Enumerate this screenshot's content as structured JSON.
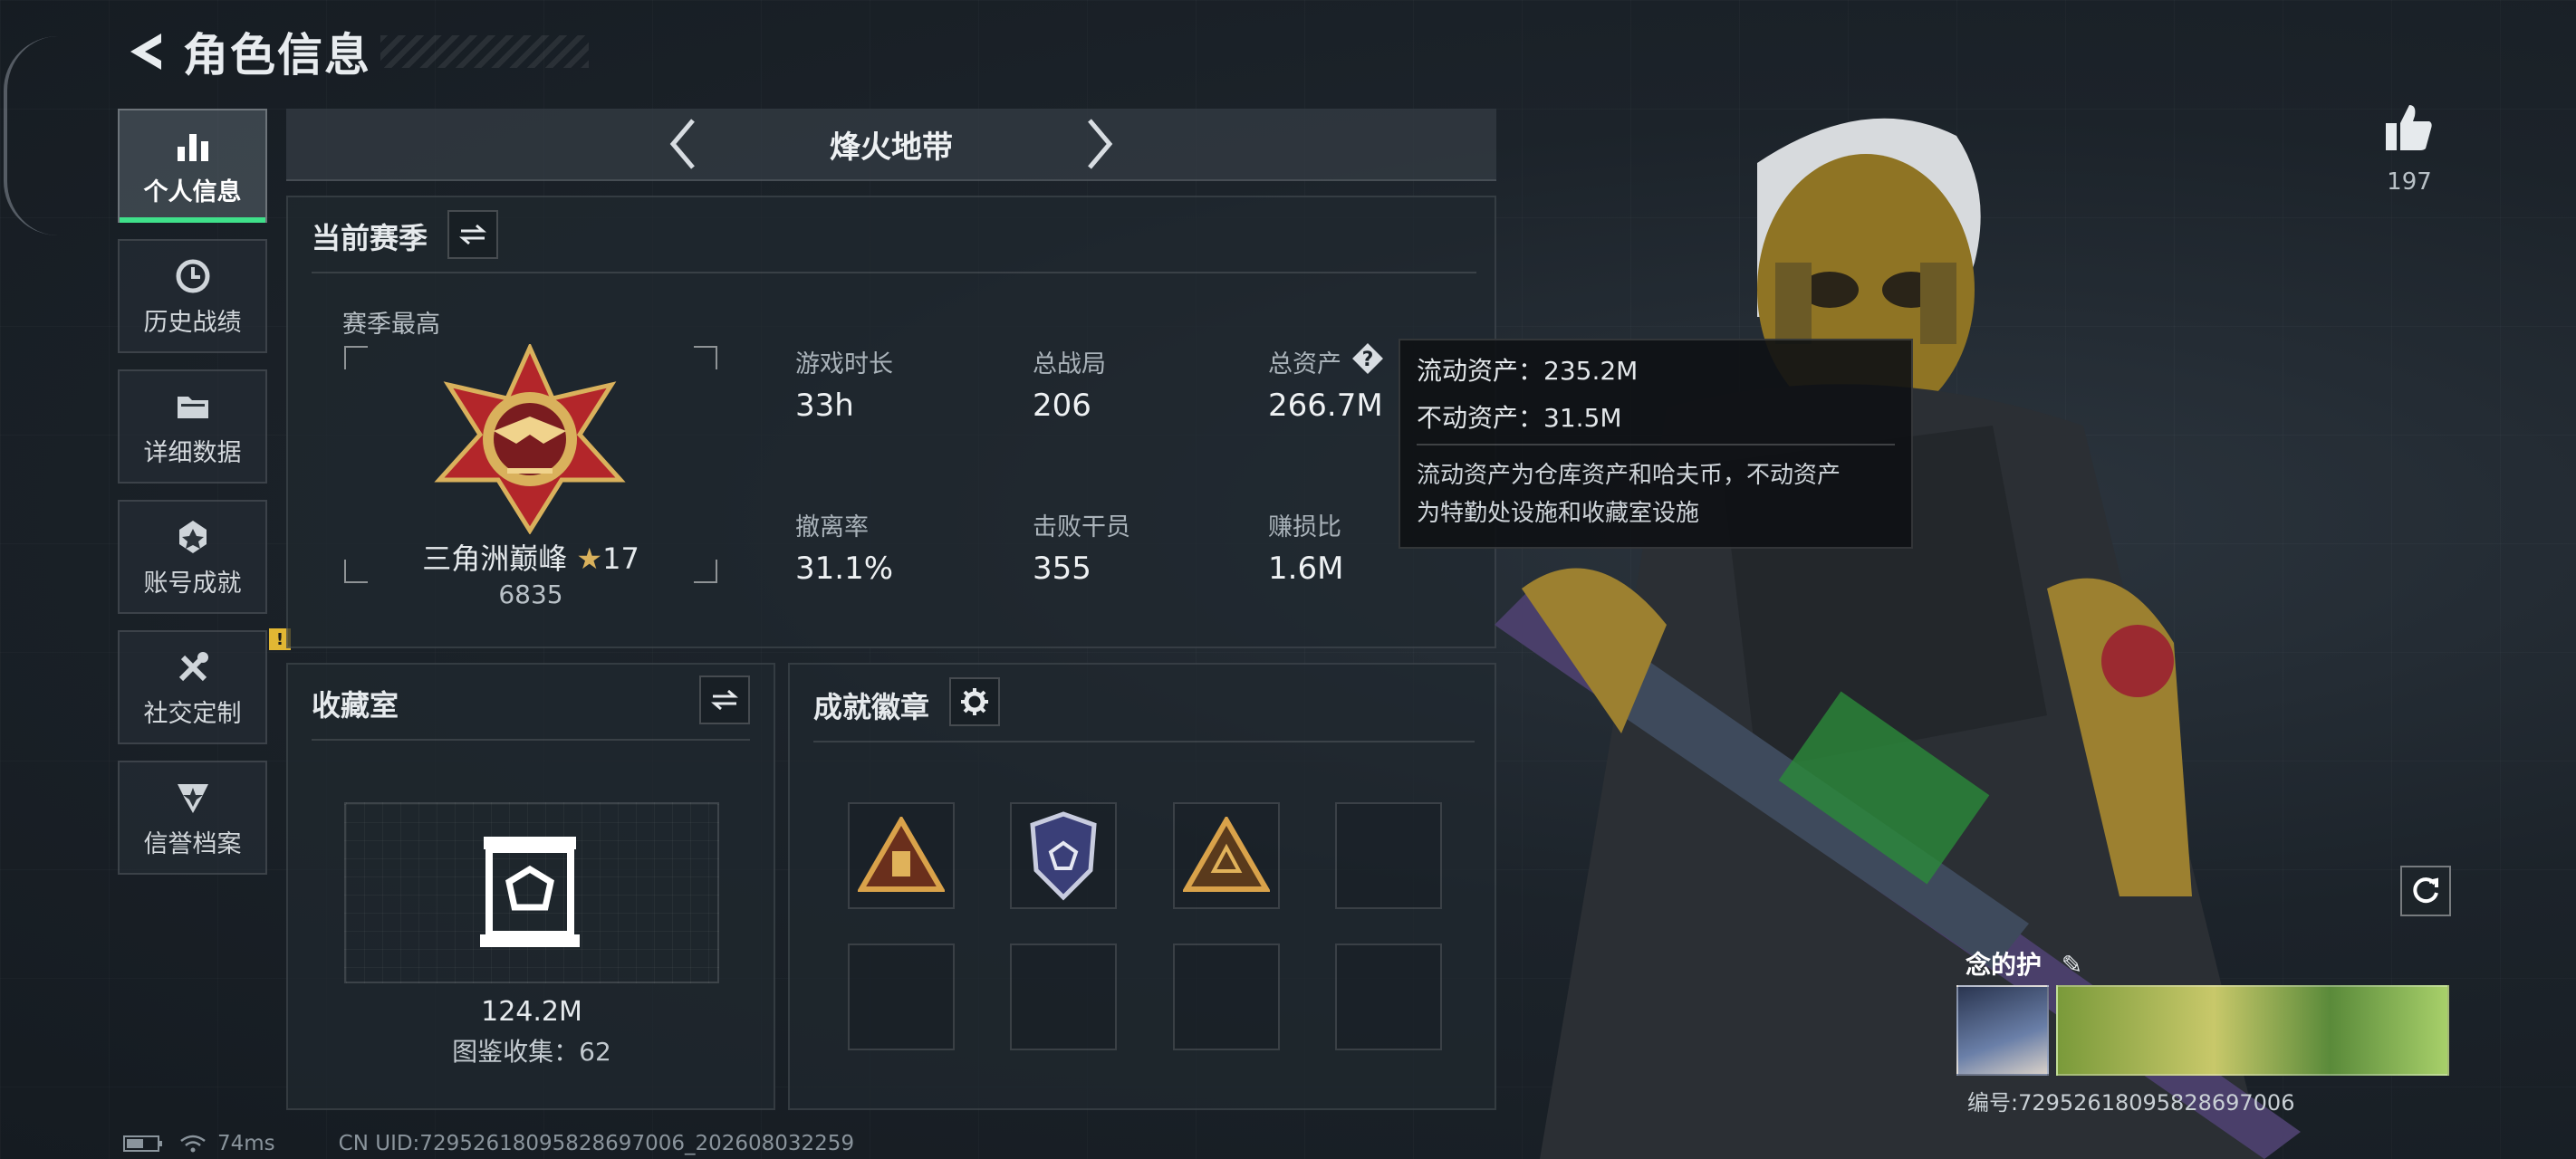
{
  "header": {
    "title": "角色信息"
  },
  "nav": {
    "items": [
      {
        "label": "个人信息",
        "icon": "bar-chart-icon",
        "active": true
      },
      {
        "label": "历史战绩",
        "icon": "history-clock-icon"
      },
      {
        "label": "详细数据",
        "icon": "folder-icon"
      },
      {
        "label": "账号成就",
        "icon": "medal-icon"
      },
      {
        "label": "社交定制",
        "icon": "tools-icon",
        "badge": "!"
      },
      {
        "label": "信誉档案",
        "icon": "shield-star-icon"
      }
    ]
  },
  "mode": {
    "title": "烽火地带"
  },
  "season": {
    "title": "当前赛季",
    "best_label": "赛季最高",
    "rank_name": "三角洲巅峰",
    "rank_stars": "17",
    "rank_score": "6835",
    "stats": [
      {
        "label": "游戏时长",
        "value": "33h"
      },
      {
        "label": "总战局",
        "value": "206"
      },
      {
        "label": "总资产",
        "value": "266.7M"
      },
      {
        "label": "撤离率",
        "value": "31.1%"
      },
      {
        "label": "击败干员",
        "value": "355"
      },
      {
        "label": "赚损比",
        "value": "1.6M"
      }
    ]
  },
  "tooltip": {
    "liquid": "流动资产：235.2M",
    "fixed": "不动资产：31.5M",
    "desc1": "流动资产为仓库资产和哈夫币，不动资产",
    "desc2": "为特勤处设施和收藏室设施"
  },
  "collection": {
    "title": "收藏室",
    "value": "124.2M",
    "catalog": "图鉴收集：62"
  },
  "achievements": {
    "title": "成就徽章",
    "badges": [
      "triangle-gold-badge",
      "shield-purple-badge",
      "triangle-dots-badge",
      "",
      "",
      "",
      "",
      ""
    ]
  },
  "profile": {
    "likes": "197",
    "guard_title": "念的护",
    "guard_id": "编号:7295261809582869​7006"
  },
  "footer": {
    "ping": "74ms",
    "uid": "CN UID:7295261809582869​7006_202608032259"
  }
}
